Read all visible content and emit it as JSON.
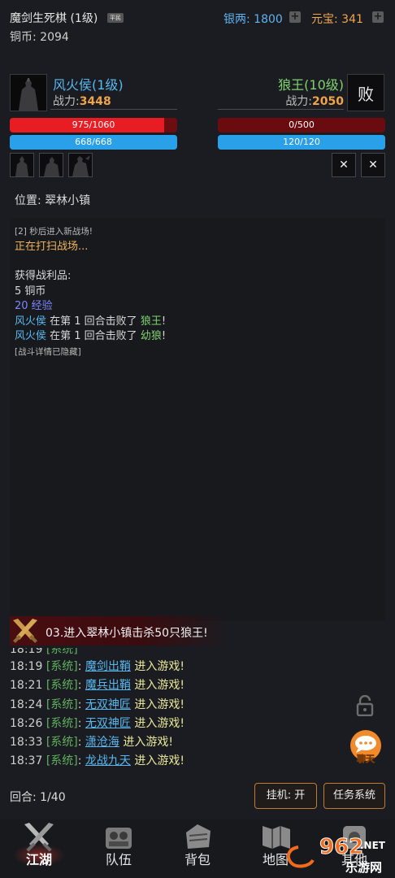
{
  "header": {
    "player_name": "魔剑生死棋 (1级)",
    "rank_badge": "平民",
    "copper_label": "铜币: 2094",
    "silver_label": "银两: 1800",
    "yuanbao_label": "元宝: 341",
    "plus": "+"
  },
  "player": {
    "name": "风火侯(1级)",
    "power_label": "战力:",
    "power": "3448",
    "hp_text": "975/1060",
    "hp_fraction": 0.92,
    "mp_text": "668/668",
    "mp_fraction": 1.0
  },
  "enemy": {
    "name": "狼王(10级)",
    "status": "败",
    "power_label": "战力:",
    "power": "2050",
    "hp_text": "0/500",
    "hp_fraction": 0.0,
    "mp_text": "120/120",
    "mp_fraction": 1.0,
    "close_symbol": "✕"
  },
  "location": "位置: 翠林小镇",
  "log": {
    "line1": "[2] 秒后进入新战场!",
    "line2": "正在打扫战场...",
    "loot_title": "获得战利品:",
    "loot_copper": "5 铜币",
    "loot_exp": "20 经验",
    "kill1_actor": "风火侯",
    "kill1_mid": " 在第 1 回合击败了 ",
    "kill1_target": "狼王",
    "kill1_end": "!",
    "kill2_actor": "风火侯",
    "kill2_mid": " 在第 1 回合击败了 ",
    "kill2_target": "幼狼",
    "kill2_end": "!",
    "hidden": "[战斗详情已隐藏]"
  },
  "quest": {
    "text": "03.进入翠林小镇击杀50只狼王!"
  },
  "chat": [
    {
      "time": "18:19",
      "channel": "[系统]",
      "sep": ": ",
      "user": "魔剑出鞘",
      "msg": " 进入游戏!"
    },
    {
      "time": "18:21",
      "channel": "[系统]",
      "sep": ": ",
      "user": "魔兵出鞘",
      "msg": " 进入游戏!"
    },
    {
      "time": "18:24",
      "channel": "[系统]",
      "sep": ": ",
      "user": "无双神匠",
      "msg": " 进入游戏!"
    },
    {
      "time": "18:26",
      "channel": "[系统]",
      "sep": ": ",
      "user": "无双神匠",
      "msg": " 进入游戏!"
    },
    {
      "time": "18:33",
      "channel": "[系统]",
      "sep": ": ",
      "user": "潇沧海",
      "msg": " 进入游戏!"
    },
    {
      "time": "18:37",
      "channel": "[系统]",
      "sep": ": ",
      "user": "龙战九天",
      "msg": " 进入游戏!"
    }
  ],
  "chat_button_label": "聊天",
  "round_label": "回合: 1/40",
  "buttons": {
    "idle": "挂机: 开",
    "tasks": "任务系统"
  },
  "nav": {
    "jianghu": "江湖",
    "team": "队伍",
    "bag": "背包",
    "map": "地图",
    "more": "其他"
  },
  "watermark": {
    "logo": "962",
    "net": ".NET",
    "sub": "乐游网"
  },
  "colors": {
    "accent_blue": "#57b8f0",
    "accent_orange": "#f0a448",
    "hp_red": "#e81d24",
    "mp_blue": "#2aa0e8",
    "enemy_green": "#7fd26f"
  }
}
